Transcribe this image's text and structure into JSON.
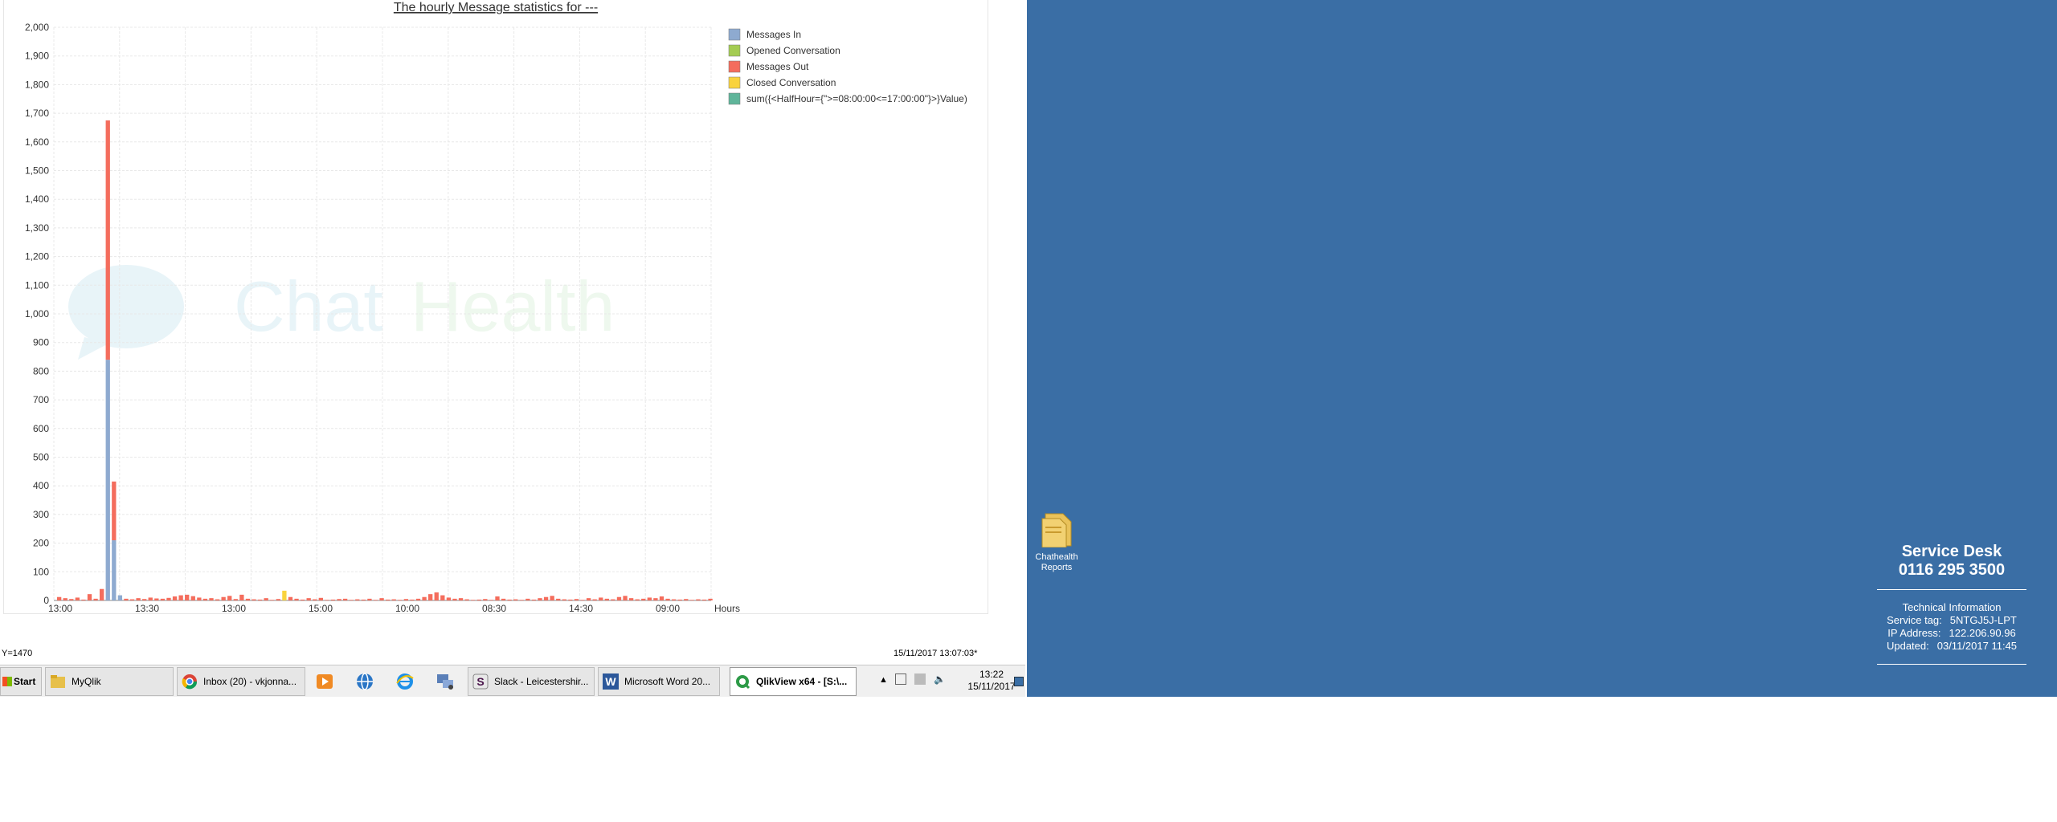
{
  "chart_data": {
    "type": "bar",
    "title": "The hourly Message statistics for ---",
    "xlabel": "Hours",
    "ylabel": "",
    "ylim": [
      0,
      2000
    ],
    "y_ticks": [
      "0",
      "100",
      "200",
      "300",
      "400",
      "500",
      "600",
      "700",
      "800",
      "900",
      "1,000",
      "1,100",
      "1,200",
      "1,300",
      "1,400",
      "1,500",
      "1,600",
      "1,700",
      "1,800",
      "1,900",
      "2,000"
    ],
    "x_ticks": [
      "13:00",
      "13:30",
      "13:00",
      "15:00",
      "10:00",
      "08:30",
      "14:30",
      "09:00"
    ],
    "stacked": true,
    "legend_position": "right",
    "series": [
      {
        "name": "Messages In",
        "color": "#8eaad0"
      },
      {
        "name": "Opened Conversation",
        "color": "#a4cc52"
      },
      {
        "name": "Messages Out",
        "color": "#f46d5d"
      },
      {
        "name": "Closed Conversation",
        "color": "#f9d33e"
      },
      {
        "name": "sum({<HalfHour={\">=08:00:00<=17:00:00\"}>}Value)",
        "color": "#5fb59a"
      }
    ],
    "points": [
      {
        "in": 0,
        "out": 12
      },
      {
        "in": 0,
        "out": 8
      },
      {
        "in": 0,
        "out": 5
      },
      {
        "in": 0,
        "out": 10
      },
      {
        "in": 0,
        "out": 3
      },
      {
        "in": 0,
        "out": 22
      },
      {
        "in": 0,
        "out": 6
      },
      {
        "in": 0,
        "out": 40
      },
      {
        "in": 840,
        "out": 835
      },
      {
        "in": 210,
        "out": 205
      },
      {
        "in": 18,
        "out": 0
      },
      {
        "in": 0,
        "out": 6
      },
      {
        "in": 0,
        "out": 4
      },
      {
        "in": 0,
        "out": 8
      },
      {
        "in": 0,
        "out": 5
      },
      {
        "in": 0,
        "out": 10
      },
      {
        "in": 0,
        "out": 7
      },
      {
        "in": 0,
        "out": 6
      },
      {
        "in": 0,
        "out": 9
      },
      {
        "in": 0,
        "out": 14
      },
      {
        "in": 0,
        "out": 18
      },
      {
        "in": 0,
        "out": 20
      },
      {
        "in": 0,
        "out": 15
      },
      {
        "in": 0,
        "out": 10
      },
      {
        "in": 0,
        "out": 6
      },
      {
        "in": 0,
        "out": 8
      },
      {
        "in": 0,
        "out": 4
      },
      {
        "in": 0,
        "out": 12
      },
      {
        "in": 0,
        "out": 16
      },
      {
        "in": 0,
        "out": 5
      },
      {
        "in": 0,
        "out": 20
      },
      {
        "in": 0,
        "out": 6
      },
      {
        "in": 0,
        "out": 4
      },
      {
        "in": 0,
        "out": 3
      },
      {
        "in": 0,
        "out": 8
      },
      {
        "in": 0,
        "out": 2
      },
      {
        "in": 0,
        "out": 5
      },
      {
        "closed": 34
      },
      {
        "in": 0,
        "out": 12
      },
      {
        "in": 0,
        "out": 6
      },
      {
        "in": 0,
        "out": 3
      },
      {
        "in": 0,
        "out": 8
      },
      {
        "in": 0,
        "out": 4
      },
      {
        "in": 0,
        "out": 9
      },
      {
        "in": 0,
        "out": 2
      },
      {
        "in": 0,
        "out": 3
      },
      {
        "in": 0,
        "out": 5
      },
      {
        "in": 0,
        "out": 6
      },
      {
        "in": 0,
        "out": 2
      },
      {
        "in": 0,
        "out": 4
      },
      {
        "in": 0,
        "out": 3
      },
      {
        "in": 0,
        "out": 6
      },
      {
        "in": 0,
        "out": 2
      },
      {
        "in": 0,
        "out": 8
      },
      {
        "in": 0,
        "out": 3
      },
      {
        "in": 0,
        "out": 4
      },
      {
        "in": 0,
        "out": 2
      },
      {
        "in": 0,
        "out": 5
      },
      {
        "in": 0,
        "out": 3
      },
      {
        "in": 0,
        "out": 6
      },
      {
        "in": 0,
        "out": 12
      },
      {
        "in": 0,
        "out": 22
      },
      {
        "in": 0,
        "out": 28
      },
      {
        "in": 0,
        "out": 18
      },
      {
        "in": 0,
        "out": 10
      },
      {
        "in": 0,
        "out": 6
      },
      {
        "in": 0,
        "out": 8
      },
      {
        "in": 0,
        "out": 4
      },
      {
        "in": 0,
        "out": 2
      },
      {
        "in": 0,
        "out": 3
      },
      {
        "in": 0,
        "out": 5
      },
      {
        "in": 0,
        "out": 2
      },
      {
        "in": 0,
        "out": 14
      },
      {
        "in": 0,
        "out": 6
      },
      {
        "in": 0,
        "out": 3
      },
      {
        "in": 0,
        "out": 4
      },
      {
        "in": 0,
        "out": 2
      },
      {
        "in": 0,
        "out": 6
      },
      {
        "in": 0,
        "out": 3
      },
      {
        "in": 0,
        "out": 8
      },
      {
        "in": 0,
        "out": 12
      },
      {
        "in": 0,
        "out": 16
      },
      {
        "in": 0,
        "out": 6
      },
      {
        "in": 0,
        "out": 4
      },
      {
        "in": 0,
        "out": 3
      },
      {
        "in": 0,
        "out": 5
      },
      {
        "in": 0,
        "out": 2
      },
      {
        "in": 0,
        "out": 8
      },
      {
        "in": 0,
        "out": 4
      },
      {
        "in": 0,
        "out": 10
      },
      {
        "in": 0,
        "out": 6
      },
      {
        "in": 0,
        "out": 4
      },
      {
        "in": 0,
        "out": 12
      },
      {
        "in": 0,
        "out": 16
      },
      {
        "in": 0,
        "out": 8
      },
      {
        "in": 0,
        "out": 4
      },
      {
        "in": 0,
        "out": 6
      },
      {
        "in": 0,
        "out": 10
      },
      {
        "in": 0,
        "out": 8
      },
      {
        "in": 0,
        "out": 14
      },
      {
        "in": 0,
        "out": 6
      },
      {
        "in": 0,
        "out": 4
      },
      {
        "in": 0,
        "out": 3
      },
      {
        "in": 0,
        "out": 5
      },
      {
        "in": 0,
        "out": 2
      },
      {
        "in": 0,
        "out": 4
      },
      {
        "in": 0,
        "out": 3
      },
      {
        "in": 0,
        "out": 6
      }
    ]
  },
  "watermark": {
    "text_chat": "Chat",
    "text_health": "Health"
  },
  "status": {
    "y_readout": "Y=1470",
    "timestamp": "15/11/2017 13:07:03*"
  },
  "taskbar": {
    "start_label": "Start",
    "buttons": [
      {
        "label": "MyQlik",
        "icon": "folder-icon"
      },
      {
        "label": "Inbox (20) - vkjonna...",
        "icon": "chrome-icon"
      },
      {
        "label": "Slack - Leicestershir...",
        "icon": "slack-icon"
      },
      {
        "label": "Microsoft Word 20...",
        "icon": "word-icon"
      },
      {
        "label": "QlikView x64 - [S:\\...",
        "icon": "qlikview-icon"
      }
    ],
    "quick_launch": [
      "media-player-icon",
      "globe-icon",
      "ie-icon",
      "network-icon"
    ],
    "clock_time": "13:22",
    "clock_date": "15/11/2017"
  },
  "desktop": {
    "folder_label_1": "Chathealth",
    "folder_label_2": "Reports",
    "service_desk_title": "Service Desk",
    "service_desk_phone": "0116 295 3500",
    "tech_info_title": "Technical Information",
    "tech_rows": [
      {
        "label": "Service tag:",
        "value": "5NTGJ5J-LPT"
      },
      {
        "label": "IP Address:",
        "value": "122.206.90.96"
      },
      {
        "label": "Updated:",
        "value": "03/11/2017 11:45"
      }
    ]
  },
  "colors": {
    "desktop_bg": "#3a6ea5",
    "grid": "#e8e8e8"
  }
}
